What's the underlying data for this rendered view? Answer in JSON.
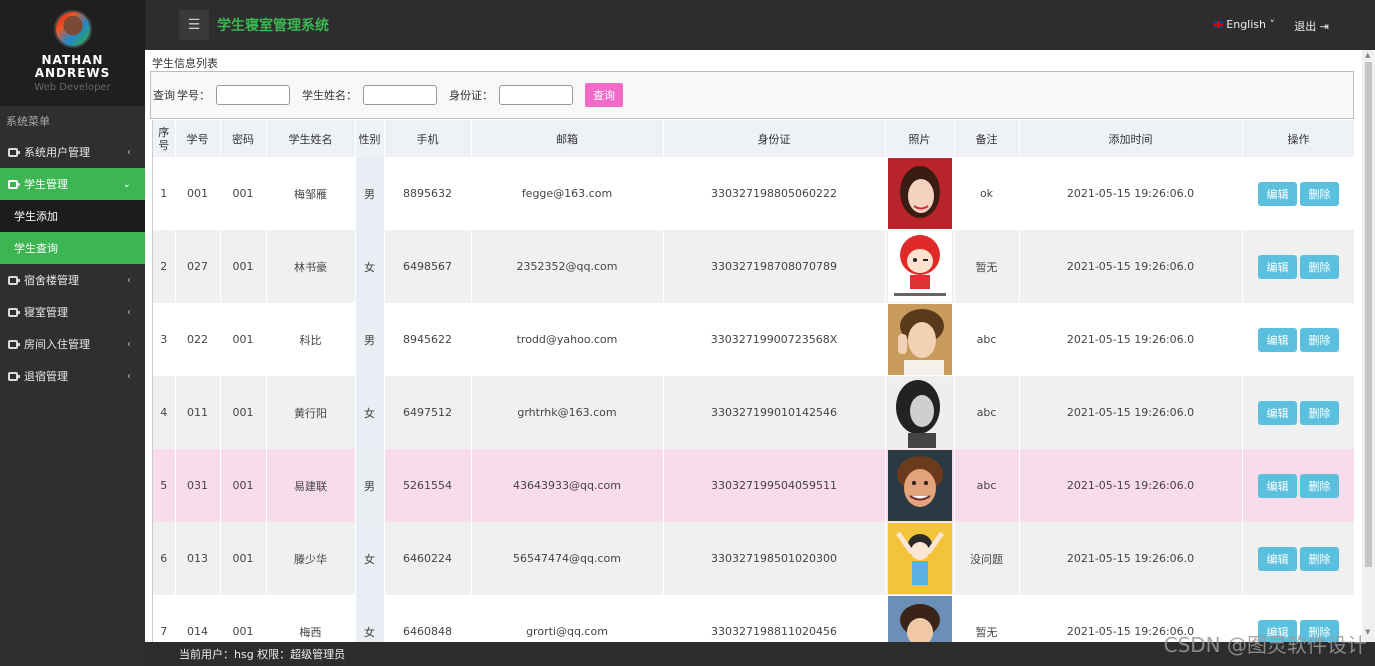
{
  "profile": {
    "name_line1": "NATHAN",
    "name_line2": "ANDREWS",
    "role": "Web Developer"
  },
  "sidebar": {
    "heading": "系统菜单",
    "items": [
      {
        "label": "系统用户管理",
        "chevron": "‹"
      },
      {
        "label": "学生管理",
        "chevron": "⌄"
      },
      {
        "label": "宿舍楼管理",
        "chevron": "‹"
      },
      {
        "label": "寝室管理",
        "chevron": "‹"
      },
      {
        "label": "房间入住管理",
        "chevron": "‹"
      },
      {
        "label": "退宿管理",
        "chevron": "‹"
      }
    ],
    "subitems": [
      {
        "label": "学生添加"
      },
      {
        "label": "学生查询"
      }
    ]
  },
  "topbar": {
    "menu_icon": "☰",
    "title": "学生寝室管理系统",
    "language": "English ˅",
    "logout": "退出 ⇥"
  },
  "main": {
    "breadcrumb": "学生信息列表",
    "search": {
      "prefix": "查询",
      "id_label": "学号：",
      "name_label": "学生姓名：",
      "idcard_label": "身份证：",
      "id_value": "",
      "name_value": "",
      "idcard_value": "",
      "button": "查询"
    },
    "table": {
      "headers": [
        "序号",
        "学号",
        "密码",
        "学生姓名",
        "性别",
        "手机",
        "邮箱",
        "身份证",
        "照片",
        "备注",
        "添加时间",
        "操作"
      ],
      "edit_label": "编辑",
      "delete_label": "删除",
      "rows": [
        {
          "seq": "1",
          "sid": "001",
          "pwd": "001",
          "name": "梅邹雁",
          "gender": "男",
          "phone": "8895632",
          "email": "fegge@163.com",
          "idcard": "330327198805060222",
          "note": "ok",
          "time": "2021-05-15 19:26:06.0",
          "photo": "photo-woman"
        },
        {
          "seq": "2",
          "sid": "027",
          "pwd": "001",
          "name": "林书豪",
          "gender": "女",
          "phone": "6498567",
          "email": "2352352@qq.com",
          "idcard": "330327198708070789",
          "note": "暂无",
          "time": "2021-05-15 19:26:06.0",
          "photo": "photo-cartoon-girl"
        },
        {
          "seq": "3",
          "sid": "022",
          "pwd": "001",
          "name": "科比",
          "gender": "男",
          "phone": "8945622",
          "email": "trodd@yahoo.com",
          "idcard": "33032719900723568X",
          "note": "abc",
          "time": "2021-05-15 19:26:06.0",
          "photo": "photo-boy"
        },
        {
          "seq": "4",
          "sid": "011",
          "pwd": "001",
          "name": "黄行阳",
          "gender": "女",
          "phone": "6497512",
          "email": "grhtrhk@163.com",
          "idcard": "330327199010142546",
          "note": "abc",
          "time": "2021-05-15 19:26:06.0",
          "photo": "photo-bw-girl"
        },
        {
          "seq": "5",
          "sid": "031",
          "pwd": "001",
          "name": "易建联",
          "gender": "男",
          "phone": "5261554",
          "email": "43643933@qq.com",
          "idcard": "330327199504059511",
          "note": "abc",
          "time": "2021-05-15 19:26:06.0",
          "photo": "photo-cartoon-man"
        },
        {
          "seq": "6",
          "sid": "013",
          "pwd": "001",
          "name": "滕少华",
          "gender": "女",
          "phone": "6460224",
          "email": "56547474@qq.com",
          "idcard": "330327198501020300",
          "note": "没问题",
          "time": "2021-05-15 19:26:06.0",
          "photo": "photo-yellow-cartoon"
        },
        {
          "seq": "7",
          "sid": "014",
          "pwd": "001",
          "name": "梅西",
          "gender": "女",
          "phone": "6460848",
          "email": "grorti@qq.com",
          "idcard": "330327198811020456",
          "note": "暂无",
          "time": "2021-05-15 19:26:06.0",
          "photo": "photo-boy2"
        }
      ]
    }
  },
  "footer": {
    "text": "当前用户：hsg 权限：超级管理员"
  },
  "watermark": "CSDN @图灵软件设计",
  "colors": {
    "accent": "#3cb553",
    "search_button": "#f06bc8",
    "action_button": "#5bc0de",
    "highlight_row": "#f9dcec"
  }
}
